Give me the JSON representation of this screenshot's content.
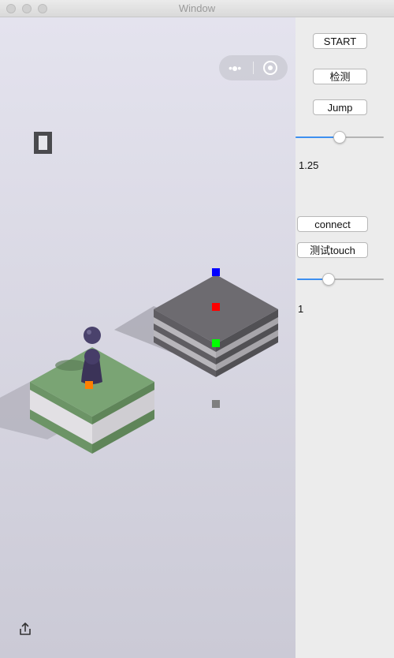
{
  "window": {
    "title": "Window"
  },
  "controls": {
    "start_label": "START",
    "detect_label": "检测",
    "jump_label": "Jump",
    "slider1_value": "1.25",
    "slider1_fraction": 0.5,
    "connect_label": "connect",
    "touch_test_label": "测试touch",
    "slider2_value": "1",
    "slider2_fraction": 0.36
  },
  "game": {
    "menu_icon": "more-dots-icon",
    "close_icon": "target-icon",
    "score_icon": "score-digit-icon",
    "share_icon": "share-icon",
    "marker_colors": {
      "blue": "#0000ff",
      "red": "#ff0000",
      "green": "#00ff00",
      "orange": "#ff8000",
      "gray": "#7f7f7f"
    }
  }
}
